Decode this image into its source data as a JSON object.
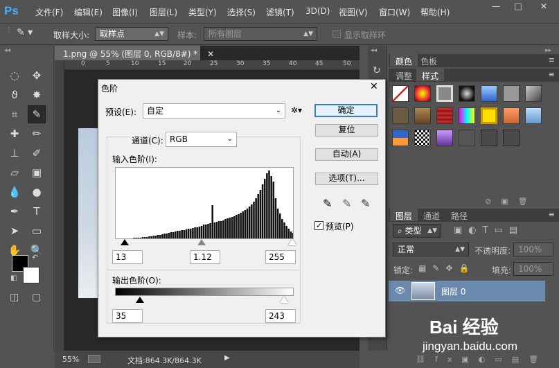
{
  "app": {
    "logo": "Ps"
  },
  "menu": {
    "items": [
      "文件(F)",
      "编辑(E)",
      "图像(I)",
      "图层(L)",
      "类型(Y)",
      "选择(S)",
      "滤镜(T)",
      "3D(D)",
      "视图(V)",
      "窗口(W)",
      "帮助(H)"
    ]
  },
  "window_controls": {
    "minimize": "—",
    "maximize": "□",
    "close": "✕"
  },
  "options": {
    "sample_size_label": "取样大小:",
    "sample_size_value": "取样点",
    "sample_label": "样本:",
    "sample_value": "所有图层",
    "show_ring_label": "显示取样环"
  },
  "document": {
    "tab_title": "1.png @ 55% (图层 0, RGB/8#) *",
    "ruler_ticks": [
      "0",
      "5",
      "10",
      "15",
      "20",
      "25",
      "30",
      "35",
      "40",
      "45",
      "50"
    ],
    "zoom": "55%",
    "doc_info": "文档:864.3K/864.3K"
  },
  "panels": {
    "tabs_top": [
      "颜色",
      "色板"
    ],
    "tabs_mid": [
      "调整",
      "样式"
    ],
    "tabs_layers": [
      "图层",
      "通道",
      "路径"
    ],
    "kind_filter": "类型",
    "blend_mode": "正常",
    "opacity_label": "不透明度:",
    "opacity_value": "100%",
    "lock_label": "锁定:",
    "fill_label": "填充:",
    "fill_value": "100%",
    "layer_name": "图层 0"
  },
  "levels_dialog": {
    "title": "色阶",
    "preset_label": "预设(E):",
    "preset_value": "自定",
    "channel_label": "通道(C):",
    "channel_value": "RGB",
    "input_label": "输入色阶(I):",
    "input_black": "13",
    "input_gamma": "1.12",
    "input_white": "255",
    "output_label": "输出色阶(O):",
    "output_black": "35",
    "output_white": "243",
    "ok": "确定",
    "reset": "复位",
    "auto": "自动(A)",
    "options": "选项(T)...",
    "preview_label": "预览(P)",
    "preview_checked": true
  },
  "watermark": {
    "brand": "Bai 经验",
    "url": "jingyan.baidu.com"
  },
  "histogram_data": [
    2,
    2,
    2,
    2,
    2,
    2,
    2,
    2,
    3,
    3,
    3,
    3,
    4,
    4,
    4,
    5,
    5,
    6,
    6,
    7,
    7,
    8,
    9,
    9,
    10,
    11,
    11,
    12,
    13,
    13,
    14,
    14,
    15,
    16,
    16,
    17,
    18,
    18,
    19,
    20,
    22,
    22,
    23,
    24,
    50,
    25,
    26,
    27,
    27,
    28,
    30,
    31,
    32,
    33,
    34,
    36,
    37,
    39,
    41,
    43,
    45,
    48,
    51,
    55,
    60,
    66,
    72,
    80,
    88,
    96,
    100,
    92,
    84,
    60,
    45,
    38,
    30,
    25,
    20,
    16,
    12,
    10
  ]
}
